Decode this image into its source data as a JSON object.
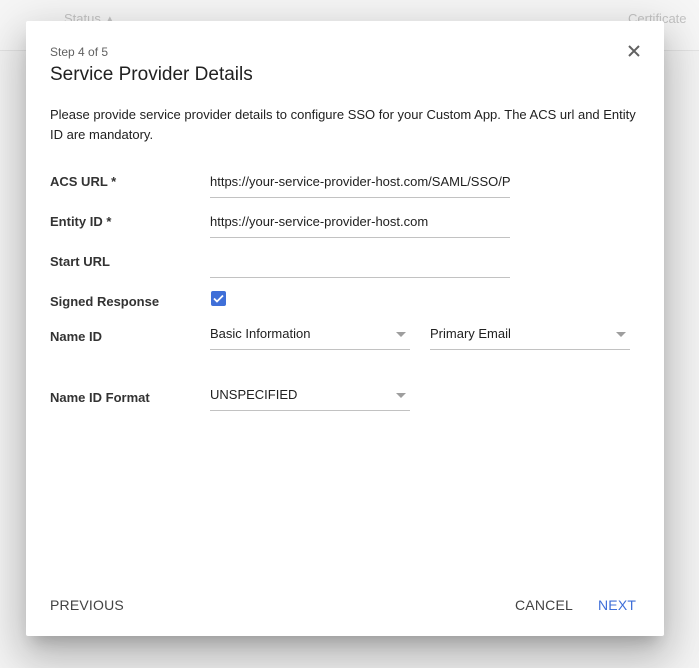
{
  "background": {
    "columns": [
      {
        "label": "Status",
        "sort_icon": "▲"
      },
      {
        "label": "Certificate"
      }
    ]
  },
  "dialog": {
    "step": "Step 4 of 5",
    "title": "Service Provider Details",
    "close_icon": "close-icon",
    "description": "Please provide service provider details to configure SSO for your Custom App. The ACS url and Entity ID are mandatory.",
    "fields": {
      "acs_url": {
        "label": "ACS URL *",
        "value": "https://your-service-provider-host.com/SAML/SSO/POST"
      },
      "entity_id": {
        "label": "Entity ID *",
        "value": "https://your-service-provider-host.com"
      },
      "start_url": {
        "label": "Start URL",
        "value": ""
      },
      "signed_response": {
        "label": "Signed Response",
        "checked": true
      },
      "name_id": {
        "label": "Name ID",
        "category": "Basic Information",
        "attribute": "Primary Email"
      },
      "name_id_format": {
        "label": "Name ID Format",
        "value": "UNSPECIFIED"
      }
    },
    "buttons": {
      "previous": "PREVIOUS",
      "cancel": "CANCEL",
      "next": "NEXT"
    },
    "colors": {
      "accent": "#3f6fd8"
    }
  }
}
